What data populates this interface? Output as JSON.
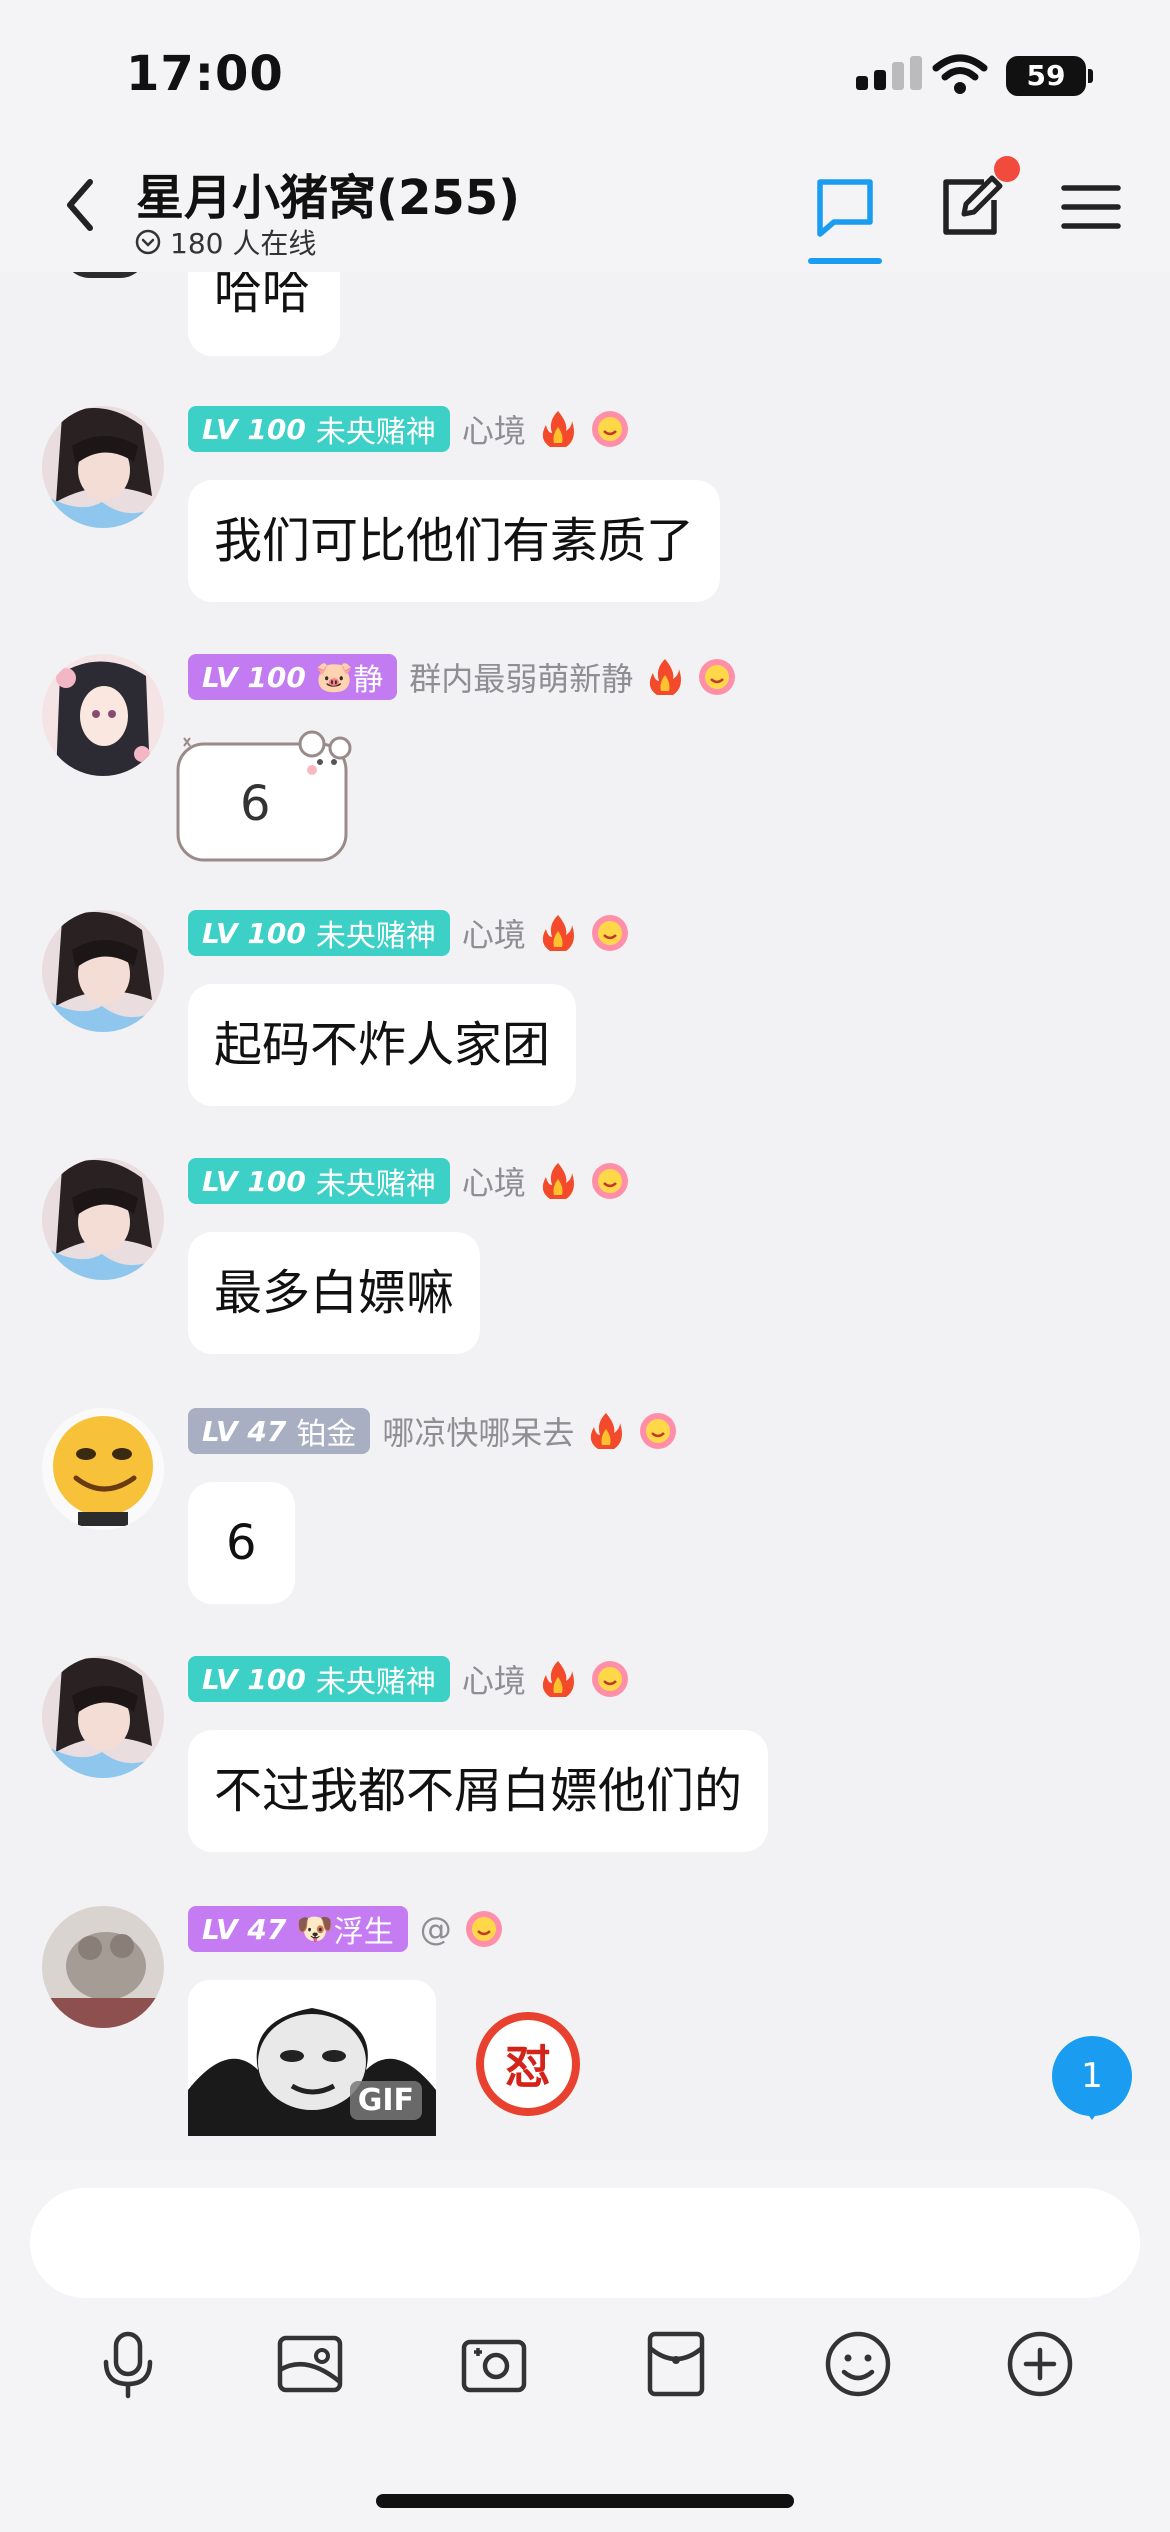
{
  "status_bar": {
    "time": "17:00",
    "battery": "59"
  },
  "header": {
    "title": "星月小猪窝(255)",
    "online": "180 人在线"
  },
  "top_partial_message": {
    "text": "哈哈"
  },
  "messages": [
    {
      "level": "LV 100",
      "title": "未央赌神",
      "nickname": "心境",
      "badge_color": "#3cd0c6",
      "text": "我们可比他们有素质了"
    },
    {
      "level": "LV 100",
      "title_emoji": "🐷",
      "title": "静",
      "nickname": "群内最弱萌新静",
      "badge_color": "#c27bf0",
      "sticker_text": "6"
    },
    {
      "level": "LV 100",
      "title": "未央赌神",
      "nickname": "心境",
      "badge_color": "#3cd0c6",
      "text": "起码不炸人家团"
    },
    {
      "level": "LV 100",
      "title": "未央赌神",
      "nickname": "心境",
      "badge_color": "#3cd0c6",
      "text": "最多白嫖嘛"
    },
    {
      "level": "LV 47",
      "title": "铂金",
      "nickname": "哪凉快哪呆去",
      "badge_color": "#a9afc2",
      "text": "6"
    },
    {
      "level": "LV 100",
      "title": "未央赌神",
      "nickname": "心境",
      "badge_color": "#3cd0c6",
      "text": "不过我都不屑白嫖他们的"
    },
    {
      "level": "LV 47",
      "title_emoji": "🐶",
      "title": "浮生",
      "nickname": "@",
      "badge_color": "#c57cf3",
      "gif_label": "GIF",
      "reaction": "怼"
    }
  ],
  "unread_count": "1",
  "input": {
    "placeholder": ""
  },
  "toolbar": [
    "microphone-icon",
    "photo-icon",
    "camera-icon",
    "red-packet-icon",
    "emoji-icon",
    "plus-icon"
  ]
}
